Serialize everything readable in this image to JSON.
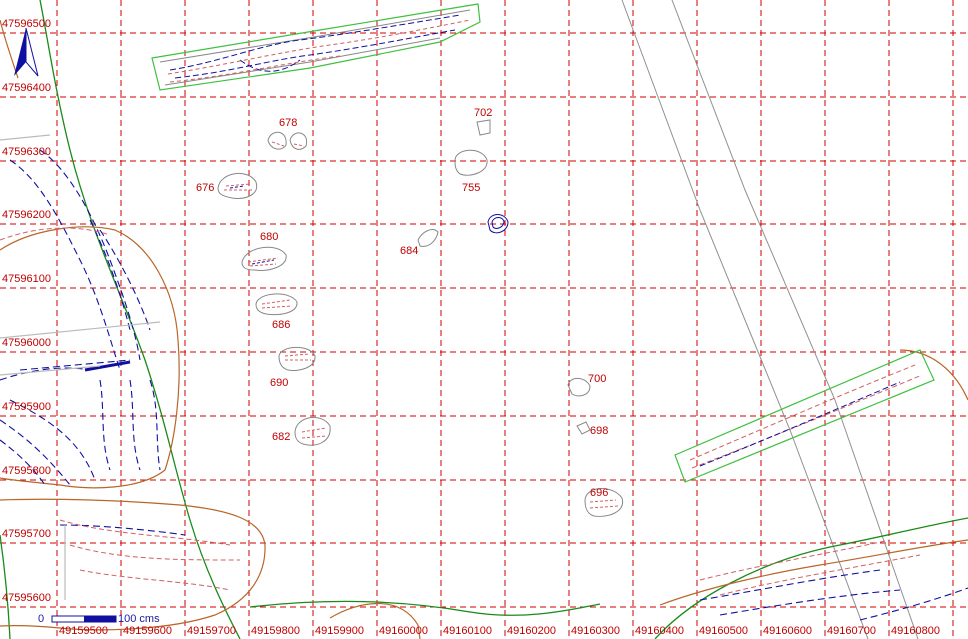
{
  "map": {
    "northing_labels": [
      "47596500",
      "47596400",
      "47596300",
      "47596200",
      "47596100",
      "47596000",
      "47595900",
      "47595800",
      "47595700",
      "47595600"
    ],
    "easting_labels": [
      "49159500",
      "49159600",
      "49159700",
      "49159800",
      "49159900",
      "49160000",
      "49160100",
      "49160200",
      "49160300",
      "49160400",
      "49160500",
      "49160600",
      "49160700",
      "49160800"
    ],
    "feature_labels": [
      "678",
      "702",
      "755",
      "676",
      "684",
      "680",
      "686",
      "690",
      "682",
      "700",
      "698",
      "696"
    ],
    "scale_bar": {
      "start": "0",
      "end": "100 cms"
    },
    "north_arrow_icon": "north-arrow-icon",
    "colors": {
      "grid": "#d00000",
      "label": "#c00000",
      "contour_red": "#d06060",
      "contour_blue": "#1010a0",
      "boundary_green": "#40c040",
      "river_green": "#1a8a1a",
      "brown": "#b8662a",
      "road_gray": "#909090"
    }
  }
}
